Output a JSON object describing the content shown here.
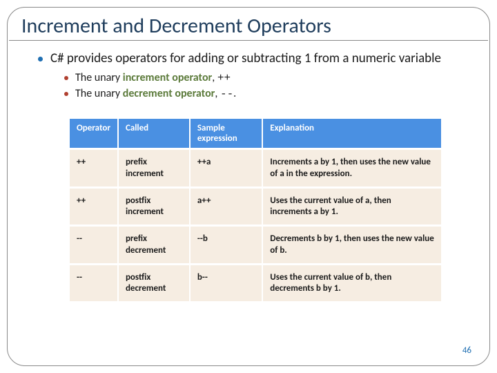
{
  "title": "Increment and Decrement Operators",
  "bullets": {
    "main": "C# provides operators for adding or subtracting 1 from a numeric variable",
    "sub1_pre": "The unary ",
    "sub1_term": "increment operator",
    "sub1_post": ", ",
    "sub1_code": "++",
    "sub2_pre": "The unary ",
    "sub2_term": "decrement operator",
    "sub2_post": ", ",
    "sub2_code": "--",
    "sub2_end": "."
  },
  "table": {
    "headers": [
      "Operator",
      "Called",
      "Sample expression",
      "Explanation"
    ],
    "rows": [
      {
        "op": "++",
        "called": "prefix increment",
        "sample": "++a",
        "exp": "Increments a by 1, then uses the new value of a in the expression."
      },
      {
        "op": "++",
        "called": "postfix increment",
        "sample": "a++",
        "exp": "Uses the current value of a, then increments a by 1."
      },
      {
        "op": "--",
        "called": "prefix decrement",
        "sample": "--b",
        "exp": "Decrements b by 1, then uses the new value of b."
      },
      {
        "op": "--",
        "called": "postfix decrement",
        "sample": "b--",
        "exp": "Uses the current value of b, then decrements b by 1."
      }
    ]
  },
  "page_number": "46"
}
